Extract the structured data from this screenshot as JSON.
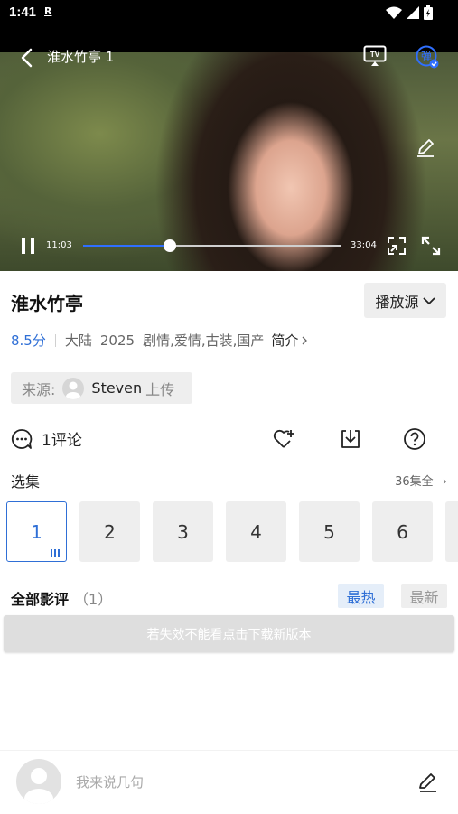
{
  "status_bar": {
    "time": "1:41",
    "r_indicator": "R"
  },
  "player": {
    "title": "淮水竹亭 1",
    "current_time": "11:03",
    "duration": "33:04",
    "progress": 0.334,
    "danmu_label": "弹"
  },
  "info": {
    "title": "淮水竹亭",
    "source_button": "播放源",
    "score": "8.5分",
    "region": "大陆",
    "year": "2025",
    "genres": "剧情,爱情,古装,国产",
    "intro": "简介"
  },
  "uploader": {
    "label": "来源:",
    "name": "Steven",
    "suffix": "上传"
  },
  "actions": {
    "comments": "1评论"
  },
  "episodes_section": {
    "title": "选集",
    "all_label": "36集全",
    "episodes": [
      "1",
      "2",
      "3",
      "4",
      "5",
      "6"
    ],
    "active_index": 0
  },
  "reviews": {
    "title": "全部影评",
    "count": "（1）",
    "tab_hot": "最热",
    "tab_new": "最新"
  },
  "notice": "若失效不能看点击下载新版本",
  "comment_bar": {
    "placeholder": "我来说几句"
  },
  "colors": {
    "accent": "#2f6fd6",
    "progress": "#2f6fff",
    "chip_bg": "#eeeeee"
  }
}
